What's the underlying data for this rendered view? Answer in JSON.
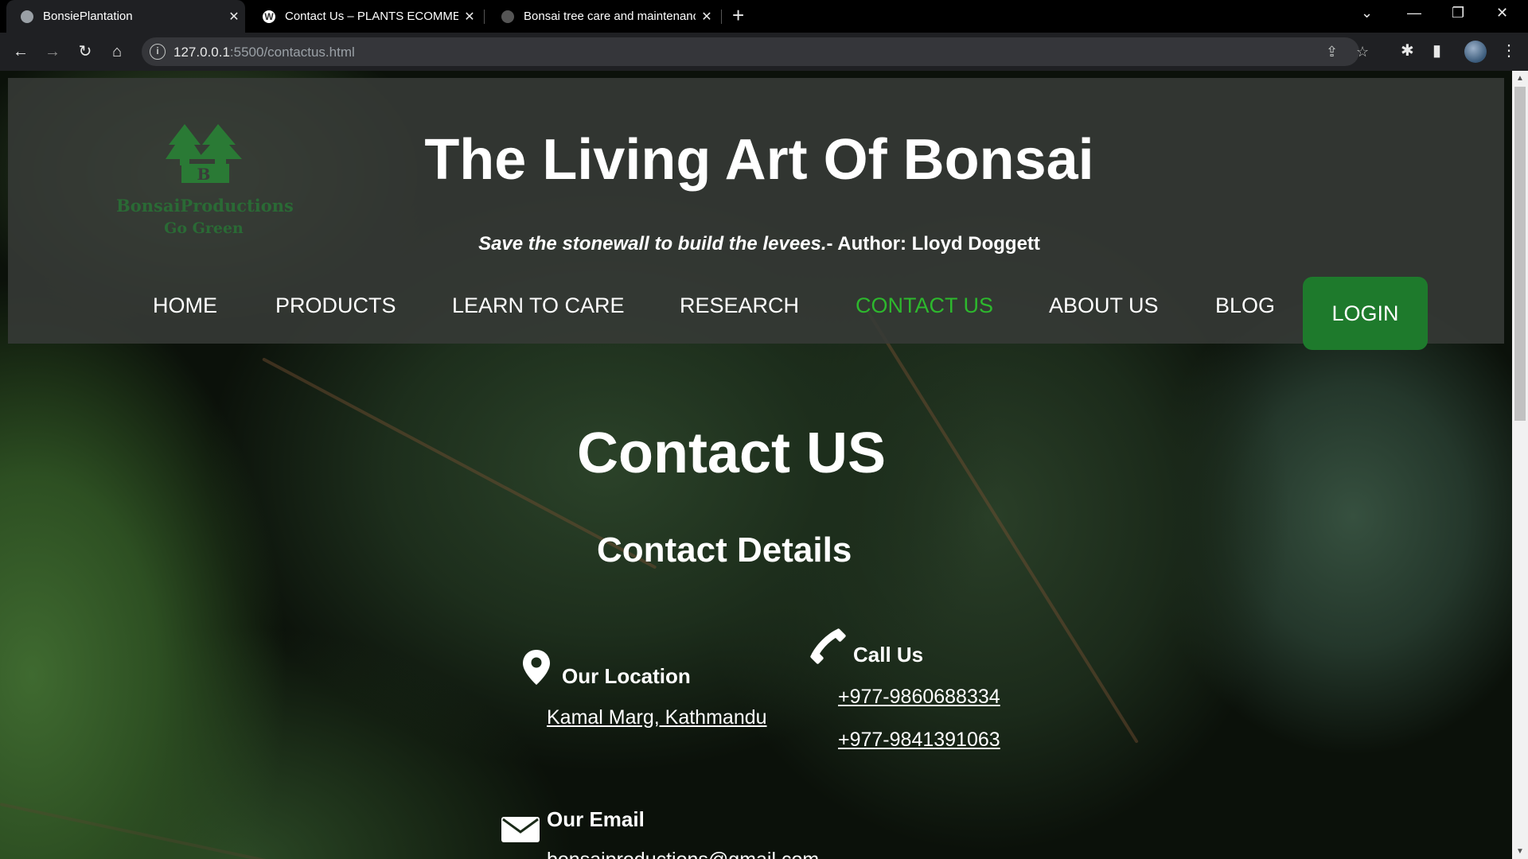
{
  "browser": {
    "tabs": [
      {
        "title": "BonsiePlantation",
        "active": true
      },
      {
        "title": "Contact Us – PLANTS ECOMMERCE",
        "active": false
      },
      {
        "title": "Bonsai tree care and maintenance",
        "active": false
      }
    ],
    "url_host": "127.0.0.1",
    "url_rest": ":5500/contactus.html"
  },
  "header": {
    "logo_name": "BonsaiProductions",
    "logo_tagline": "Go Green",
    "logo_letter": "B",
    "title": "The Living Art Of Bonsai",
    "quote": "Save the stonewall to build the levees.",
    "quote_author": "- Author: Lloyd Doggett"
  },
  "nav": {
    "items": [
      "HOME",
      "PRODUCTS",
      "LEARN TO CARE",
      "RESEARCH",
      "CONTACT US",
      "ABOUT US",
      "BLOG"
    ],
    "current": "CONTACT US",
    "login_label": "LOGIN"
  },
  "contact": {
    "title": "Contact US",
    "details_title": "Contact Details",
    "location_label": "Our Location",
    "location_value": "Kamal Marg, Kathmandu",
    "call_label": "Call Us",
    "phones": [
      "+977-9860688334",
      "+977-9841391063"
    ],
    "email_label": "Our Email",
    "email_value": "bonsaiproductions@gmail.com"
  },
  "colors": {
    "accent_green": "#2db82d",
    "login_green": "#1e7a2c",
    "header_bg": "#3a3c3a"
  }
}
